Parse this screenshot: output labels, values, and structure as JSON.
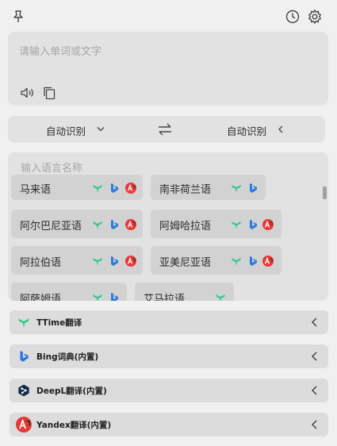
{
  "input": {
    "placeholder": "请输入单词或文字"
  },
  "language_bar": {
    "source": "自动识别",
    "target": "自动识别"
  },
  "language_list": {
    "placeholder": "输入语言名称",
    "items": [
      "马来语",
      "南非荷兰语",
      "阿尔巴尼亚语",
      "阿姆哈拉语",
      "阿拉伯语",
      "亚美尼亚语",
      "阿萨姆语",
      "艾马拉语"
    ]
  },
  "services": [
    {
      "label": "TTime翻译"
    },
    {
      "label": "Bing词典(内置)"
    },
    {
      "label": "DeepL翻译(内置)"
    },
    {
      "label": "Yandex翻译(内置)"
    }
  ],
  "colors": {
    "ttime": "#2fc98a",
    "bing": "#2a7ae2",
    "deepl": "#0f2b46",
    "yandex": "#e53935"
  }
}
